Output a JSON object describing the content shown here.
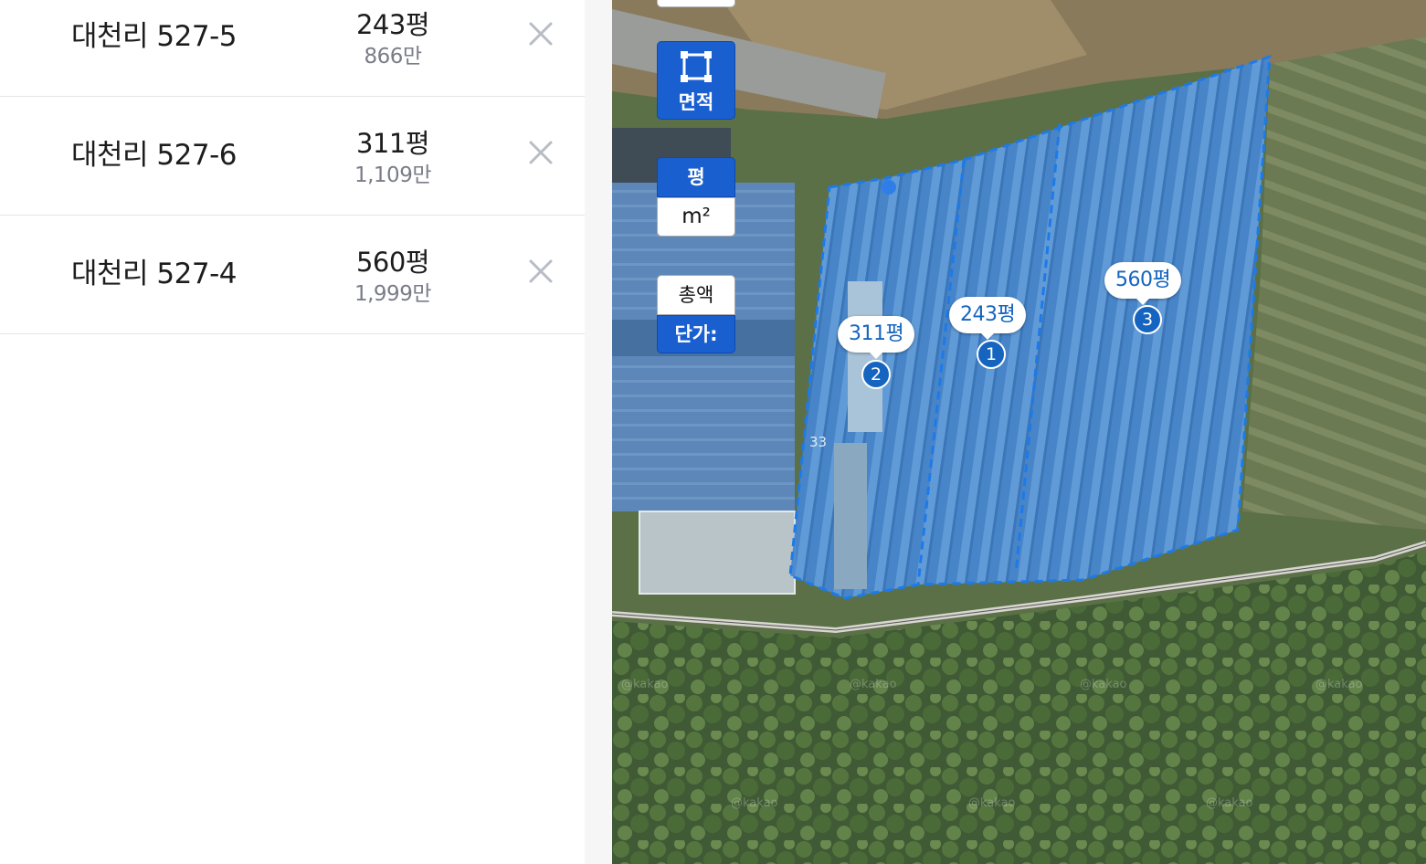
{
  "parcels": [
    {
      "address": "대천리 527-5",
      "area": "243평",
      "price": "866만"
    },
    {
      "address": "대천리 527-6",
      "area": "311평",
      "price": "1,109만"
    },
    {
      "address": "대천리 527-4",
      "area": "560평",
      "price": "1,999만"
    }
  ],
  "controls": {
    "area_button_label": "면적",
    "unit_pyeong": "평",
    "unit_m2": "m²",
    "total_label": "총액",
    "unit_price_label": "단가:"
  },
  "map": {
    "labels": [
      {
        "area": "311평",
        "marker": "2"
      },
      {
        "area": "243평",
        "marker": "1"
      },
      {
        "area": "560평",
        "marker": "3"
      }
    ],
    "road_number": "33",
    "watermark": "@kakao"
  },
  "colors": {
    "accent": "#1565c0",
    "button_blue": "#1a5fd0",
    "polygon_fill": "#1e78e6"
  }
}
